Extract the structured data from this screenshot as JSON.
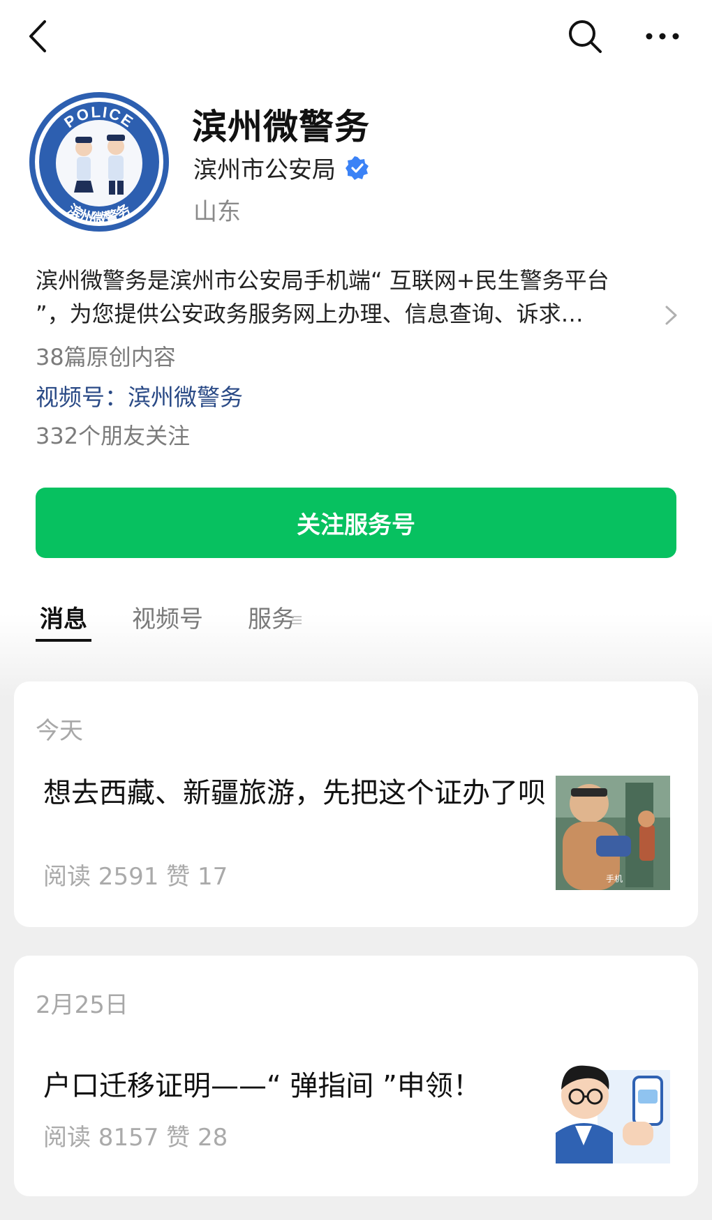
{
  "header": {
    "back_icon": "chevron-left-icon",
    "search_icon": "search-icon",
    "more_icon": "more-dots-icon"
  },
  "profile": {
    "avatar_badge_top": "POLICE",
    "avatar_badge_bottom": "滨州微警务",
    "name": "滨州微警务",
    "org": "滨州市公安局",
    "verified_icon": "verified-badge-icon",
    "region": "山东"
  },
  "description": "滨州微警务是滨州市公安局手机端“ 互联网+民生警务平台 ”，为您提供公安政务服务网上办理、信息查询、诉求…",
  "stats": {
    "original_count": "38篇原创内容",
    "channel_link": "视频号：滨州微警务",
    "friends_following": "332个朋友关注"
  },
  "follow_button": "关注服务号",
  "tabs": [
    {
      "label": "消息",
      "active": true
    },
    {
      "label": "视频号",
      "active": false
    },
    {
      "label": "服务",
      "active": false
    }
  ],
  "messages": [
    {
      "date": "今天",
      "title": "想去西藏、新疆旅游，先把这个证办了呗",
      "meta": "阅读 2591   赞 17",
      "thumb_caption": "手机"
    },
    {
      "date": "2月25日",
      "title": "户口迁移证明——“ 弹指间 ”申领！",
      "meta": "阅读 8157   赞 28"
    }
  ],
  "colors": {
    "accent_green": "#07c160",
    "link_blue": "#2a4a86",
    "verified_blue": "#3b82f6"
  }
}
